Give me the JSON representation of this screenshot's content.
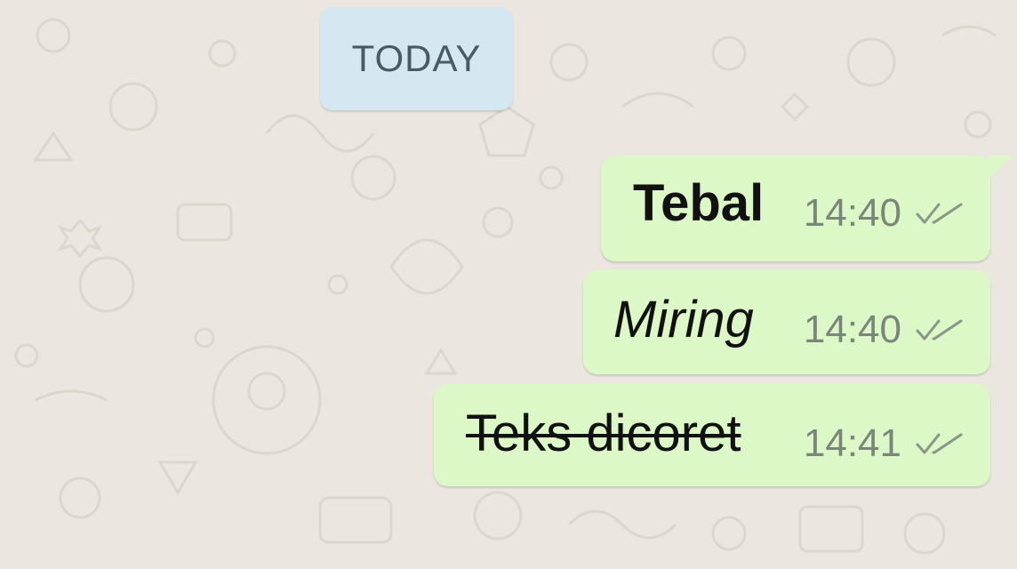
{
  "chat": {
    "date_chip": "TODAY",
    "messages": [
      {
        "text": "Tebal",
        "style": "bold",
        "time": "14:40",
        "status_icon": "double-check-icon"
      },
      {
        "text": "Miring",
        "style": "italic",
        "time": "14:40",
        "status_icon": "double-check-icon"
      },
      {
        "text": "Teks dicoret",
        "style": "strikethrough",
        "time": "14:41",
        "status_icon": "double-check-icon"
      }
    ]
  },
  "colors": {
    "background": "#ebe6df",
    "outgoing_bubble": "#dcf8c6",
    "date_chip": "#d5e8f2",
    "tick_color": "#8a968a"
  }
}
